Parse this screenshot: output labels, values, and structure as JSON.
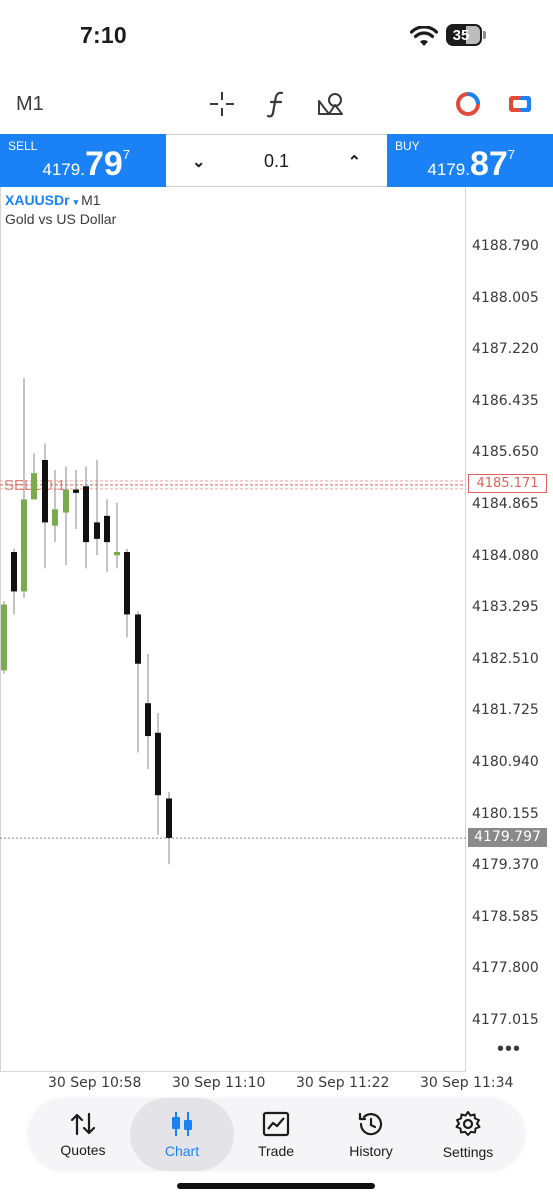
{
  "status_bar": {
    "time": "7:10",
    "battery": "35"
  },
  "toolbar": {
    "timeframe": "M1"
  },
  "trade_panel": {
    "sell": {
      "label": "SELL",
      "price_main": "4179.",
      "price_big": "79",
      "price_sup": "7"
    },
    "buy": {
      "label": "BUY",
      "price_main": "4179.",
      "price_big": "87",
      "price_sup": "7"
    },
    "volume": "0.1"
  },
  "chart_header": {
    "symbol": "XAUUSDr",
    "symbol_arrow": "▾",
    "timeframe": "M1",
    "description": "Gold vs US Dollar"
  },
  "price_axis": [
    "4188.790",
    "4188.005",
    "4187.220",
    "4186.435",
    "4185.650",
    "4184.865",
    "4184.080",
    "4183.295",
    "4182.510",
    "4181.725",
    "4180.940",
    "4180.155",
    "4179.370",
    "4178.585",
    "4177.800",
    "4177.015"
  ],
  "current_price": "4179.797",
  "order_line": {
    "label": "SELL 0.1",
    "price": "4185.171"
  },
  "time_axis": [
    "30 Sep 10:58",
    "30 Sep 11:10",
    "30 Sep 11:22",
    "30 Sep 11:34"
  ],
  "more_label": "•••",
  "chart_data": {
    "type": "candlestick",
    "symbol": "XAUUSDr",
    "timeframe": "M1",
    "ylim": [
      4176.7,
      4189.2
    ],
    "candles": [
      {
        "open": 4182.35,
        "high": 4183.4,
        "low": 4182.3,
        "close": 4183.35,
        "color": "bull"
      },
      {
        "open": 4183.55,
        "high": 4184.2,
        "low": 4183.2,
        "close": 4184.15,
        "color": "bear"
      },
      {
        "open": 4183.55,
        "high": 4186.8,
        "low": 4183.45,
        "close": 4184.95,
        "color": "bull"
      },
      {
        "open": 4184.95,
        "high": 4185.65,
        "low": 4184.95,
        "close": 4185.35,
        "color": "bull"
      },
      {
        "open": 4185.55,
        "high": 4185.8,
        "low": 4183.9,
        "close": 4184.6,
        "color": "bear"
      },
      {
        "open": 4184.55,
        "high": 4185.4,
        "low": 4184.3,
        "close": 4184.8,
        "color": "bull"
      },
      {
        "open": 4184.75,
        "high": 4185.45,
        "low": 4183.95,
        "close": 4185.1,
        "color": "bull"
      },
      {
        "open": 4185.1,
        "high": 4185.4,
        "low": 4184.5,
        "close": 4185.05,
        "color": "bear"
      },
      {
        "open": 4185.15,
        "high": 4185.45,
        "low": 4183.9,
        "close": 4184.3,
        "color": "bear"
      },
      {
        "open": 4184.6,
        "high": 4185.55,
        "low": 4184.1,
        "close": 4184.35,
        "color": "bear"
      },
      {
        "open": 4184.7,
        "high": 4184.95,
        "low": 4183.85,
        "close": 4184.3,
        "color": "bear"
      },
      {
        "open": 4184.15,
        "high": 4184.9,
        "low": 4183.9,
        "close": 4184.1,
        "color": "bull"
      },
      {
        "open": 4184.15,
        "high": 4184.2,
        "low": 4182.85,
        "close": 4183.2,
        "color": "bear"
      },
      {
        "open": 4183.2,
        "high": 4183.25,
        "low": 4181.1,
        "close": 4182.45,
        "color": "bear"
      },
      {
        "open": 4181.85,
        "high": 4182.6,
        "low": 4180.85,
        "close": 4181.35,
        "color": "bear"
      },
      {
        "open": 4181.4,
        "high": 4181.7,
        "low": 4179.85,
        "close": 4180.45,
        "color": "bear"
      },
      {
        "open": 4180.4,
        "high": 4180.5,
        "low": 4179.4,
        "close": 4179.8,
        "color": "bear"
      }
    ]
  },
  "bottom_nav": [
    {
      "label": "Quotes",
      "icon": "quotes-arrows-icon",
      "active": false
    },
    {
      "label": "Chart",
      "icon": "candlestick-chart-icon",
      "active": true
    },
    {
      "label": "Trade",
      "icon": "trade-chart-icon",
      "active": false
    },
    {
      "label": "History",
      "icon": "history-clock-icon",
      "active": false
    },
    {
      "label": "Settings",
      "icon": "gear-icon",
      "active": false
    }
  ]
}
